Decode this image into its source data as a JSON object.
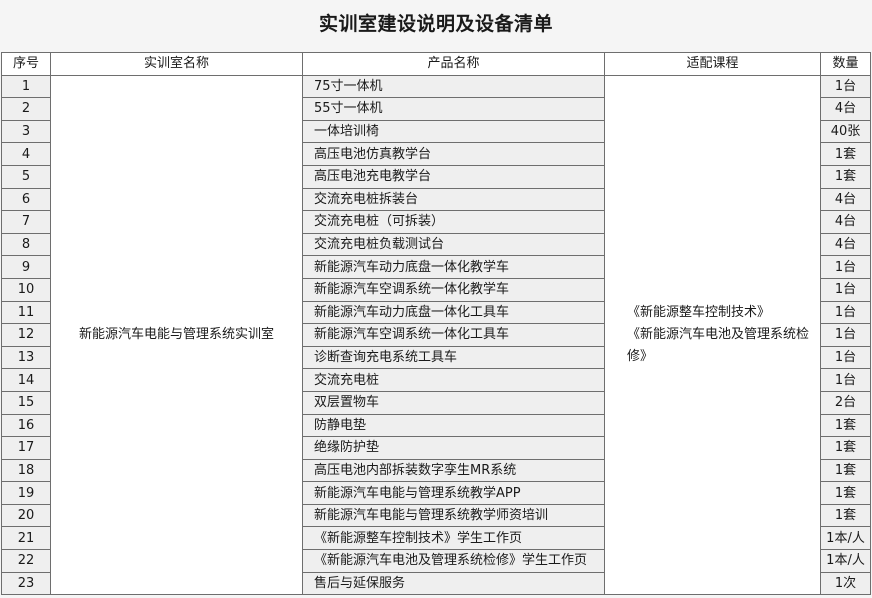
{
  "title": "实训室建设说明及设备清单",
  "table": {
    "headers": [
      "序号",
      "实训室名称",
      "产品名称",
      "适配课程",
      "数量"
    ],
    "room_name": "新能源汽车电能与管理系统实训室",
    "courses": [
      "《新能源整车控制技术》",
      "《新能源汽车电池及管理系统检修》"
    ],
    "rows": [
      {
        "idx": "1",
        "product": "75寸一体机",
        "qty": "1台"
      },
      {
        "idx": "2",
        "product": "55寸一体机",
        "qty": "4台"
      },
      {
        "idx": "3",
        "product": "一体培训椅",
        "qty": "40张"
      },
      {
        "idx": "4",
        "product": "高压电池仿真教学台",
        "qty": "1套"
      },
      {
        "idx": "5",
        "product": "高压电池充电教学台",
        "qty": "1套"
      },
      {
        "idx": "6",
        "product": "交流充电桩拆装台",
        "qty": "4台"
      },
      {
        "idx": "7",
        "product": "交流充电桩（可拆装）",
        "qty": "4台"
      },
      {
        "idx": "8",
        "product": "交流充电桩负载测试台",
        "qty": "4台"
      },
      {
        "idx": "9",
        "product": "新能源汽车动力底盘一体化教学车",
        "qty": "1台"
      },
      {
        "idx": "10",
        "product": "新能源汽车空调系统一体化教学车",
        "qty": "1台"
      },
      {
        "idx": "11",
        "product": "新能源汽车动力底盘一体化工具车",
        "qty": "1台"
      },
      {
        "idx": "12",
        "product": "新能源汽车空调系统一体化工具车",
        "qty": "1台"
      },
      {
        "idx": "13",
        "product": "诊断查询充电系统工具车",
        "qty": "1台"
      },
      {
        "idx": "14",
        "product": "交流充电桩",
        "qty": "1台"
      },
      {
        "idx": "15",
        "product": "双层置物车",
        "qty": "2台"
      },
      {
        "idx": "16",
        "product": "防静电垫",
        "qty": "1套"
      },
      {
        "idx": "17",
        "product": "绝缘防护垫",
        "qty": "1套"
      },
      {
        "idx": "18",
        "product": "高压电池内部拆装数字孪生MR系统",
        "qty": "1套"
      },
      {
        "idx": "19",
        "product": "新能源汽车电能与管理系统教学APP",
        "qty": "1套"
      },
      {
        "idx": "20",
        "product": "新能源汽车电能与管理系统教学师资培训",
        "qty": "1套"
      },
      {
        "idx": "21",
        "product": "《新能源整车控制技术》学生工作页",
        "qty": "1本/人"
      },
      {
        "idx": "22",
        "product": "《新能源汽车电池及管理系统检修》学生工作页",
        "qty": "1本/人"
      },
      {
        "idx": "23",
        "product": "售后与延保服务",
        "qty": "1次"
      }
    ]
  }
}
